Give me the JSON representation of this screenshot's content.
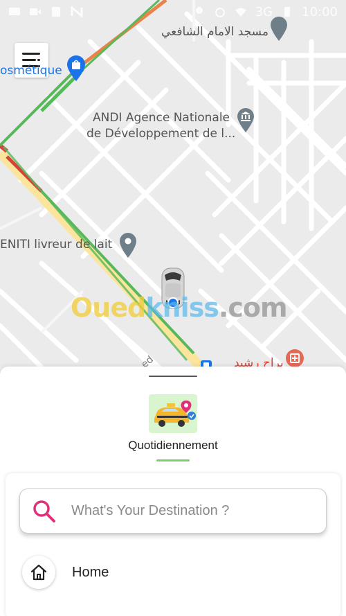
{
  "status_bar": {
    "network": "3G",
    "time": "10:00"
  },
  "map": {
    "pois": [
      {
        "name": "مسجد الامام الشافعي",
        "icon": "mosque-pin-icon"
      },
      {
        "name": "ANDI Agence Nationale",
        "name2": "de Développement de l...",
        "icon": "museum-pin-icon"
      },
      {
        "name": "ENITI livreur de lait",
        "icon": "location-pin-icon"
      },
      {
        "name": "osmétique",
        "icon": "shopping-pin-icon"
      },
      {
        "name": "براح رشيد",
        "icon": "hospital-pin-icon"
      }
    ],
    "colors": {
      "road_main": "#fbe59c",
      "traffic_green": "#58b85c",
      "traffic_orange": "#e8834a",
      "traffic_red": "#d9423a",
      "poi_text": "#555555",
      "blue_pin": "#1a73e8"
    }
  },
  "watermark": {
    "part1": "Oued",
    "part2": "kniss",
    "part3": ".com"
  },
  "sheet": {
    "service_label": "Quotidiennement",
    "search_placeholder": "What's Your Destination ?",
    "home_label": "Home",
    "accent_color": "#e0307a"
  }
}
